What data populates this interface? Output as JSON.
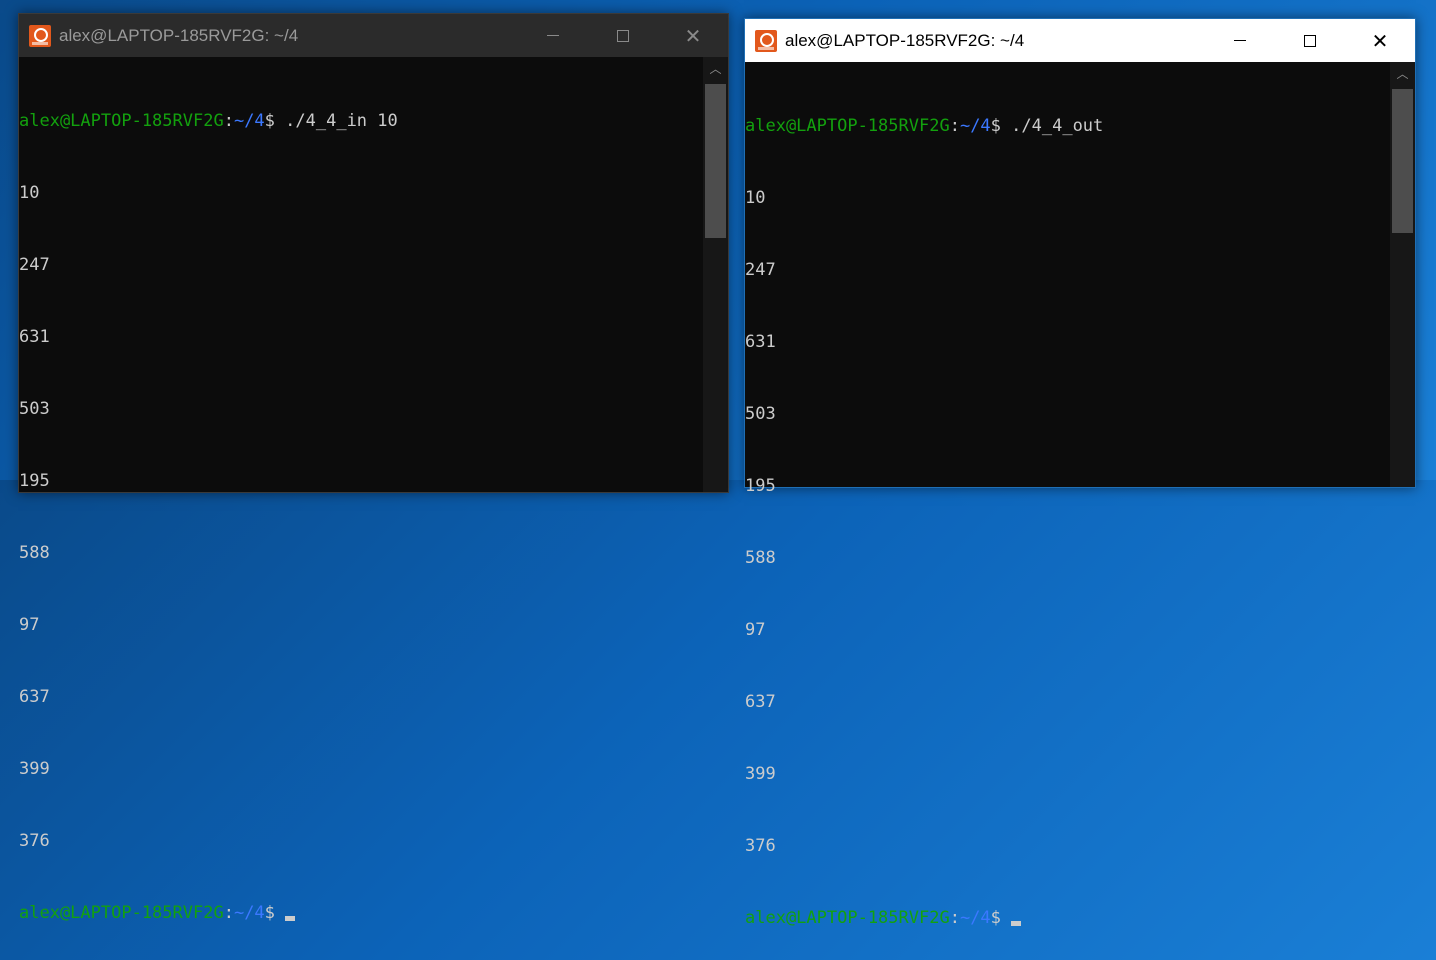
{
  "colors": {
    "terminal_bg": "#0c0c0c",
    "terminal_text": "#cccccc",
    "prompt_user": "#13a10e",
    "prompt_path": "#3b78ff",
    "titlebar_inactive": "#2b2b2b",
    "titlebar_active": "#ffffff",
    "app_icon": "#e2581c"
  },
  "icons": {
    "app": "ubuntu-app-icon",
    "minimize": "minimize-icon",
    "maximize": "maximize-icon",
    "close": "close-icon",
    "scroll_up": "chevron-up-icon"
  },
  "windows": [
    {
      "title": "alex@LAPTOP-185RVF2G: ~/4",
      "active": false,
      "prompt_user": "alex@LAPTOP-185RVF2G",
      "prompt_sep": ":",
      "prompt_path": "~/4",
      "prompt_sym": "$ ",
      "command": "./4_4_in 10",
      "output": [
        "10",
        "247",
        "631",
        "503",
        "195",
        "588",
        "97",
        "637",
        "399",
        "376"
      ]
    },
    {
      "title": "alex@LAPTOP-185RVF2G: ~/4",
      "active": true,
      "prompt_user": "alex@LAPTOP-185RVF2G",
      "prompt_sep": ":",
      "prompt_path": "~/4",
      "prompt_sym": "$ ",
      "command": "./4_4_out",
      "output": [
        "10",
        "247",
        "631",
        "503",
        "195",
        "588",
        "97",
        "637",
        "399",
        "376"
      ]
    }
  ]
}
